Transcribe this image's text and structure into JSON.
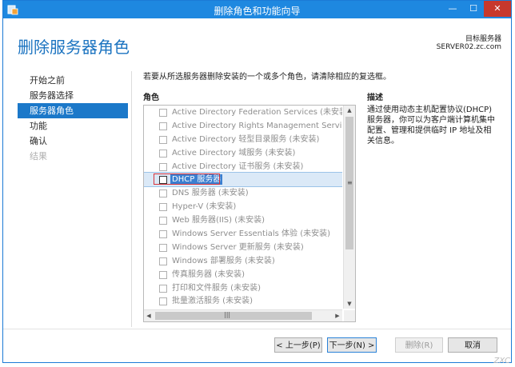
{
  "window": {
    "title": "删除角色和功能向导",
    "controls": {
      "minimize": "—",
      "maximize": "☐",
      "close": "✕"
    }
  },
  "header": {
    "heading": "删除服务器角色",
    "destination_label": "目标服务器",
    "destination_server": "SERVER02.zc.com"
  },
  "nav": {
    "items": [
      {
        "label": "开始之前",
        "state": "normal"
      },
      {
        "label": "服务器选择",
        "state": "normal"
      },
      {
        "label": "服务器角色",
        "state": "active"
      },
      {
        "label": "功能",
        "state": "normal"
      },
      {
        "label": "确认",
        "state": "normal"
      },
      {
        "label": "结果",
        "state": "disabled"
      }
    ]
  },
  "main": {
    "instruction": "若要从所选服务器删除安装的一个或多个角色，请清除相应的复选框。",
    "roles_header": "角色",
    "description_header": "描述",
    "roles": [
      {
        "label": "Active Directory Federation Services (未安装)",
        "checked": false,
        "selected": false
      },
      {
        "label": "Active Directory Rights Management Services",
        "checked": false,
        "selected": false
      },
      {
        "label": "Active Directory 轻型目录服务 (未安装)",
        "checked": false,
        "selected": false
      },
      {
        "label": "Active Directory 域服务 (未安装)",
        "checked": false,
        "selected": false
      },
      {
        "label": "Active Directory 证书服务 (未安装)",
        "checked": false,
        "selected": false
      },
      {
        "label": "DHCP 服务器",
        "checked": false,
        "selected": true
      },
      {
        "label": "DNS 服务器 (未安装)",
        "checked": false,
        "selected": false
      },
      {
        "label": "Hyper-V (未安装)",
        "checked": false,
        "selected": false
      },
      {
        "label": "Web 服务器(IIS) (未安装)",
        "checked": false,
        "selected": false
      },
      {
        "label": "Windows Server Essentials 体验 (未安装)",
        "checked": false,
        "selected": false
      },
      {
        "label": "Windows Server 更新服务 (未安装)",
        "checked": false,
        "selected": false
      },
      {
        "label": "Windows 部署服务 (未安装)",
        "checked": false,
        "selected": false
      },
      {
        "label": "传真服务器 (未安装)",
        "checked": false,
        "selected": false
      },
      {
        "label": "打印和文件服务 (未安装)",
        "checked": false,
        "selected": false
      },
      {
        "label": "批量激活服务 (未安装)",
        "checked": false,
        "selected": false
      }
    ],
    "description": "通过使用动态主机配置协议(DHCP)服务器，你可以为客户端计算机集中配置、管理和提供临时 IP 地址及相关信息。"
  },
  "buttons": {
    "previous": "< 上一步(P)",
    "next": "下一步(N) >",
    "remove": "删除(R)",
    "cancel": "取消"
  },
  "watermark": "ZXC",
  "colors": {
    "titlebar": "#1e88e0",
    "accent": "#1b73c0",
    "nav_active": "#1b78c9",
    "highlight": "#d8343c"
  }
}
